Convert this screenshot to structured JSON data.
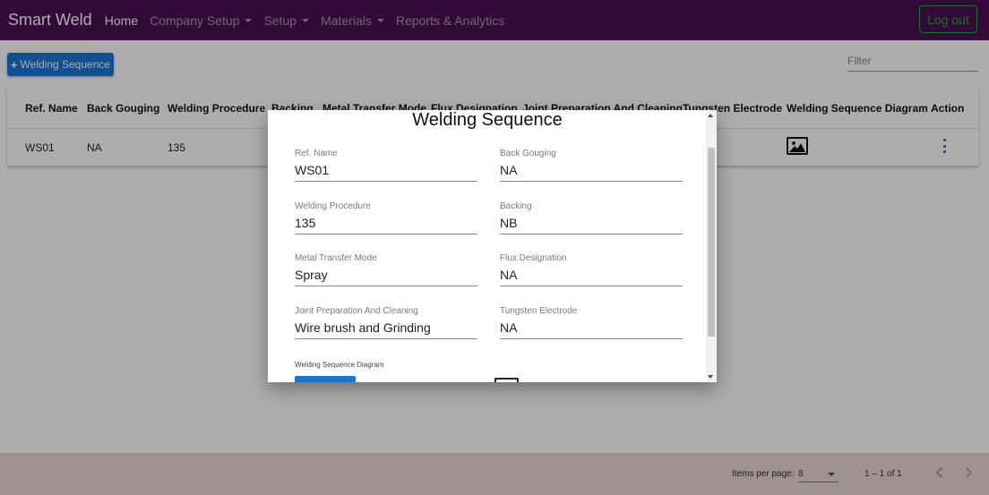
{
  "navbar": {
    "brand": "Smart Weld",
    "items": [
      {
        "label": "Home",
        "active": true,
        "dropdown": false
      },
      {
        "label": "Company Setup",
        "active": false,
        "dropdown": true
      },
      {
        "label": "Setup",
        "active": false,
        "dropdown": true
      },
      {
        "label": "Materials",
        "active": false,
        "dropdown": true
      },
      {
        "label": "Reports & Analytics",
        "active": false,
        "dropdown": false
      }
    ],
    "logout_label": "Log out"
  },
  "toolbar": {
    "add_label": "Welding Sequence",
    "filter_placeholder": "Filter"
  },
  "table": {
    "headers": [
      "Ref. Name",
      "Back Gouging",
      "Welding Procedure",
      "Backing",
      "Metal Transfer Mode",
      "Flux Designation",
      "Joint Preparation And Cleaning",
      "Tungsten Electrode",
      "Welding Sequence Diagram",
      "Action"
    ],
    "rows": [
      {
        "ref_name": "WS01",
        "back_gouging": "NA",
        "welding_procedure": "135"
      }
    ]
  },
  "paginator": {
    "items_per_page_label": "Items per page:",
    "page_size": "8",
    "range_label": "1 – 1 of 1"
  },
  "dialog": {
    "title": "Welding Sequence",
    "fields": [
      {
        "label": "Ref. Name",
        "value": "WS01"
      },
      {
        "label": "Back Gouging",
        "value": "NA"
      },
      {
        "label": "Welding Procedure",
        "value": "135"
      },
      {
        "label": "Backing",
        "value": "NB"
      },
      {
        "label": "Metal Transfer Mode",
        "value": "Spray"
      },
      {
        "label": "Flux Designation",
        "value": "NA"
      },
      {
        "label": "Joint Preparation And Cleaning",
        "value": "Wire brush and Grinding"
      },
      {
        "label": "Tungsten Electrode",
        "value": "NA"
      }
    ],
    "diagram_label": "Welding Sequence Diagram"
  },
  "colors": {
    "navbar_bg": "#4b0f52",
    "primary": "#1976d2",
    "logout": "#28a745",
    "footer_bg": "#e9d7d7"
  }
}
